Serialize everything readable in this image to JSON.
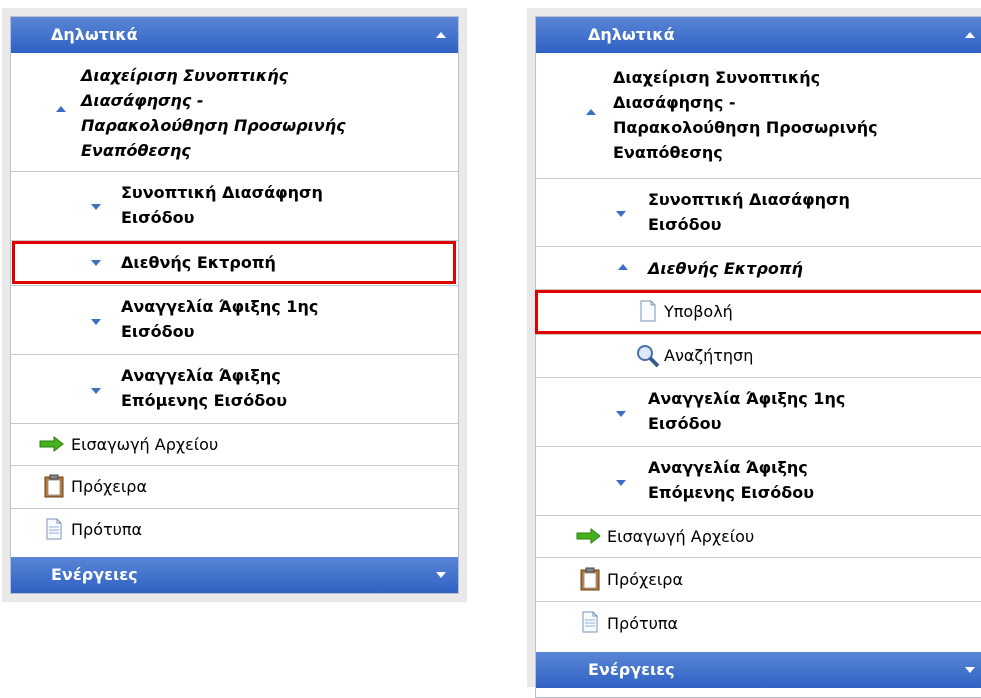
{
  "left": {
    "header": {
      "title": "Δηλωτικά"
    },
    "items": [
      {
        "label_lines": [
          "Διαχείριση Συνοπτικής",
          "Διασάφησης -",
          "Παρακολούθηση Προσωρινής",
          "Εναπόθεσης"
        ]
      },
      {
        "label_lines": [
          "Συνοπτική Διασάφηση",
          "Εισόδου"
        ]
      },
      {
        "label": "Διεθνής Εκτροπή"
      },
      {
        "label_lines": [
          "Αναγγελία Άφιξης 1ης",
          "Εισόδου"
        ]
      },
      {
        "label_lines": [
          "Αναγγελία Άφιξης",
          "Επόμενης Εισόδου"
        ]
      },
      {
        "label": "Εισαγωγή Αρχείου"
      },
      {
        "label": "Πρόχειρα"
      },
      {
        "label": "Πρότυπα"
      }
    ],
    "footer": {
      "title": "Ενέργειες"
    }
  },
  "right": {
    "header": {
      "title": "Δηλωτικά"
    },
    "items": [
      {
        "label_lines": [
          "Διαχείριση Συνοπτικής",
          "Διασάφησης -",
          "Παρακολούθηση Προσωρινής",
          "Εναπόθεσης"
        ]
      },
      {
        "label_lines": [
          "Συνοπτική Διασάφηση",
          "Εισόδου"
        ]
      },
      {
        "label": "Διεθνής Εκτροπή"
      },
      {
        "label": "Υποβολή"
      },
      {
        "label": "Αναζήτηση"
      },
      {
        "label_lines": [
          "Αναγγελία Άφιξης 1ης",
          "Εισόδου"
        ]
      },
      {
        "label_lines": [
          "Αναγγελία Άφιξης",
          "Επόμενης Εισόδου"
        ]
      },
      {
        "label": "Εισαγωγή Αρχείου"
      },
      {
        "label": "Πρόχειρα"
      },
      {
        "label": "Πρότυπα"
      }
    ],
    "footer": {
      "title": "Ενέργειες"
    }
  },
  "colors": {
    "header_top": "#5a86d6",
    "header_bottom": "#2f61c4",
    "highlight": "#e00000",
    "arrow": "#3b6fc7"
  }
}
